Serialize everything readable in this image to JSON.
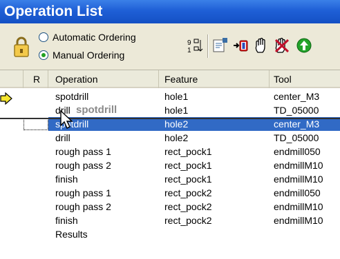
{
  "window": {
    "title": "Operation List"
  },
  "toolbar": {
    "ordering": {
      "automatic_label": "Automatic Ordering",
      "manual_label": "Manual Ordering",
      "selected": "manual"
    },
    "icons": [
      "lock-icon",
      "sort-icon",
      "properties-icon",
      "move-icon",
      "hand-icon",
      "delete-icon",
      "go-icon"
    ]
  },
  "table": {
    "headers": {
      "r": "R",
      "operation": "Operation",
      "feature": "Feature",
      "tool": "Tool"
    },
    "rows": [
      {
        "operation": "spotdrill",
        "feature": "hole1",
        "tool": "center_M3"
      },
      {
        "operation": "drill",
        "feature": "hole1",
        "tool": "TD_05000"
      },
      {
        "operation": "spotdrill",
        "feature": "hole2",
        "tool": "center_M3"
      },
      {
        "operation": "drill",
        "feature": "hole2",
        "tool": "TD_05000"
      },
      {
        "operation": "rough pass 1",
        "feature": "rect_pock1",
        "tool": "endmill050"
      },
      {
        "operation": "rough pass 2",
        "feature": "rect_pock1",
        "tool": "endmillM10"
      },
      {
        "operation": "finish",
        "feature": "rect_pock1",
        "tool": "endmillM10"
      },
      {
        "operation": "rough pass 1",
        "feature": "rect_pock2",
        "tool": "endmill050"
      },
      {
        "operation": "rough pass 2",
        "feature": "rect_pock2",
        "tool": "endmillM10"
      },
      {
        "operation": "finish",
        "feature": "rect_pock2",
        "tool": "endmillM10"
      },
      {
        "operation": "Results",
        "feature": "",
        "tool": ""
      }
    ],
    "drag_ghost_label": "spotdrill"
  },
  "colors": {
    "title_bar": "#1f5fd6",
    "selection": "#316ac5",
    "toolbar_bg": "#ece9d8"
  }
}
